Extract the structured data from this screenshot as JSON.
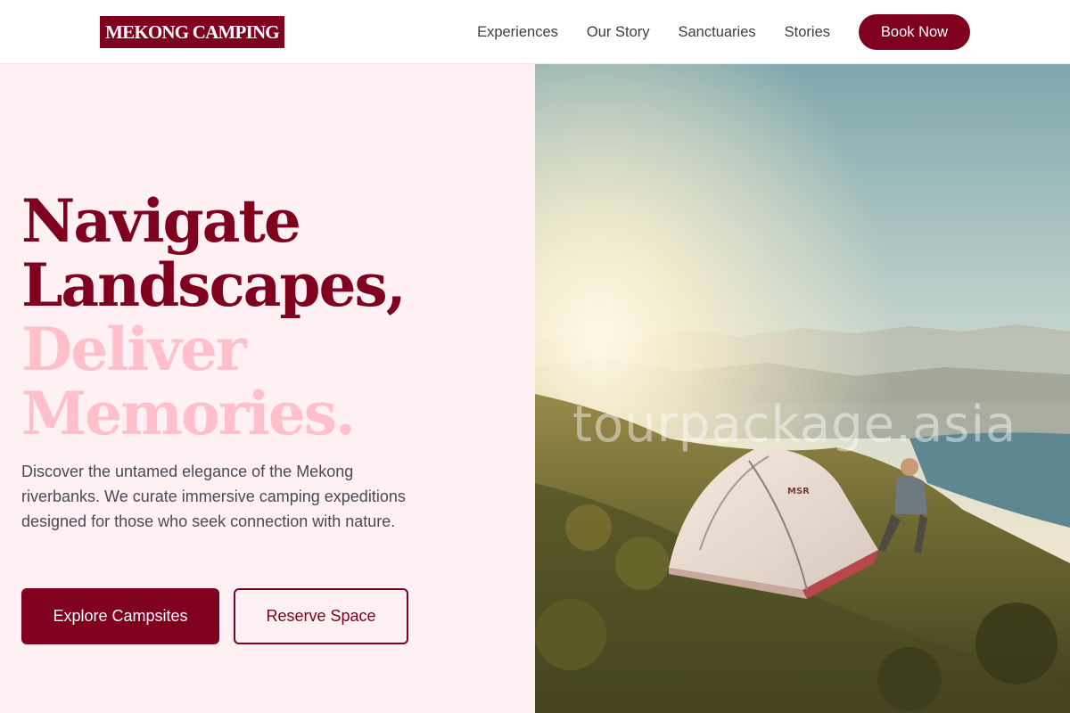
{
  "header": {
    "logo": "MEKONG CAMPING",
    "nav": [
      "Experiences",
      "Our Story",
      "Sanctuaries",
      "Stories"
    ],
    "cta": "Book Now"
  },
  "hero": {
    "headline_lines": [
      "Navigate",
      "Landscapes,",
      "Deliver",
      "Memories."
    ],
    "description": "Discover the untamed elegance of the Mekong riverbanks. We curate immersive camping expeditions designed for those who seek connection with nature.",
    "primary_button": "Explore Campsites",
    "secondary_button": "Reserve Space"
  },
  "photo": {
    "watermark": "tourpackage.asia",
    "tent_brand": "MSR"
  },
  "colors": {
    "brand": "#800020",
    "brand_light": "#ffc0cb",
    "hero_bg": "#fff0f4"
  }
}
